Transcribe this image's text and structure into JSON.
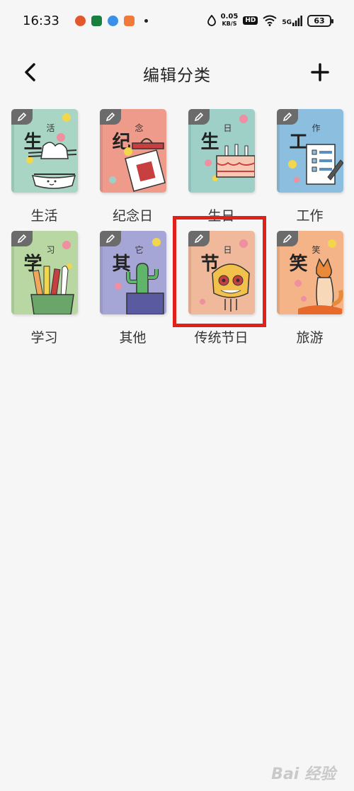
{
  "status_bar": {
    "time": "16:33",
    "net_speed_value": "0.05",
    "net_speed_unit": "KB/S",
    "hd": "HD",
    "signal_type": "5G",
    "battery": "63"
  },
  "header": {
    "title": "编辑分类"
  },
  "categories": [
    {
      "label": "生活",
      "cover_char": "生",
      "cover_small": "活",
      "bg": "#a8d5c4"
    },
    {
      "label": "纪念日",
      "cover_char": "纪",
      "cover_small": "念",
      "bg": "#ef9b8c"
    },
    {
      "label": "生日",
      "cover_char": "生",
      "cover_small": "日",
      "bg": "#9fd0c8"
    },
    {
      "label": "工作",
      "cover_char": "工",
      "cover_small": "作",
      "bg": "#8cbfdf"
    },
    {
      "label": "学习",
      "cover_char": "学",
      "cover_small": "习",
      "bg": "#b8d7a3"
    },
    {
      "label": "其他",
      "cover_char": "其",
      "cover_small": "它",
      "bg": "#a6a6d6"
    },
    {
      "label": "传统节日",
      "cover_char": "节",
      "cover_small": "日",
      "bg": "#f1b99c"
    },
    {
      "label": "旅游",
      "cover_char": "笑",
      "cover_small": "笑",
      "bg": "#f5b488"
    }
  ],
  "watermark": "Bai 经验"
}
